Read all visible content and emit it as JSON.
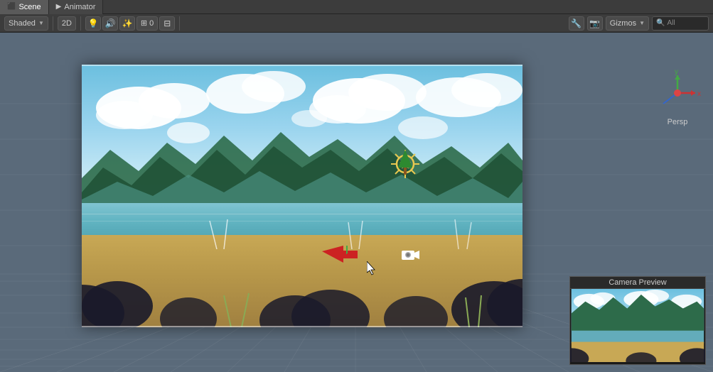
{
  "tabs": [
    {
      "id": "scene",
      "label": "Scene",
      "icon": "⬛",
      "active": true
    },
    {
      "id": "animator",
      "label": "Animator",
      "icon": "▶",
      "active": false
    }
  ],
  "toolbar": {
    "shading": {
      "label": "Shaded",
      "active": true
    },
    "view2d": {
      "label": "2D"
    },
    "lighting_icon": "💡",
    "audio_icon": "🔊",
    "fx_icon": "✨",
    "layers_icon": "⊞",
    "layout_icon": "⊟",
    "tools_icon": "🔧",
    "gizmos_label": "Gizmos",
    "search_placeholder": "All",
    "search_icon": "🔍"
  },
  "scene": {
    "perspective": "Persp"
  },
  "camera_preview": {
    "title": "Camera Preview"
  },
  "gizmo": {
    "x_label": "x",
    "y_label": "y"
  }
}
